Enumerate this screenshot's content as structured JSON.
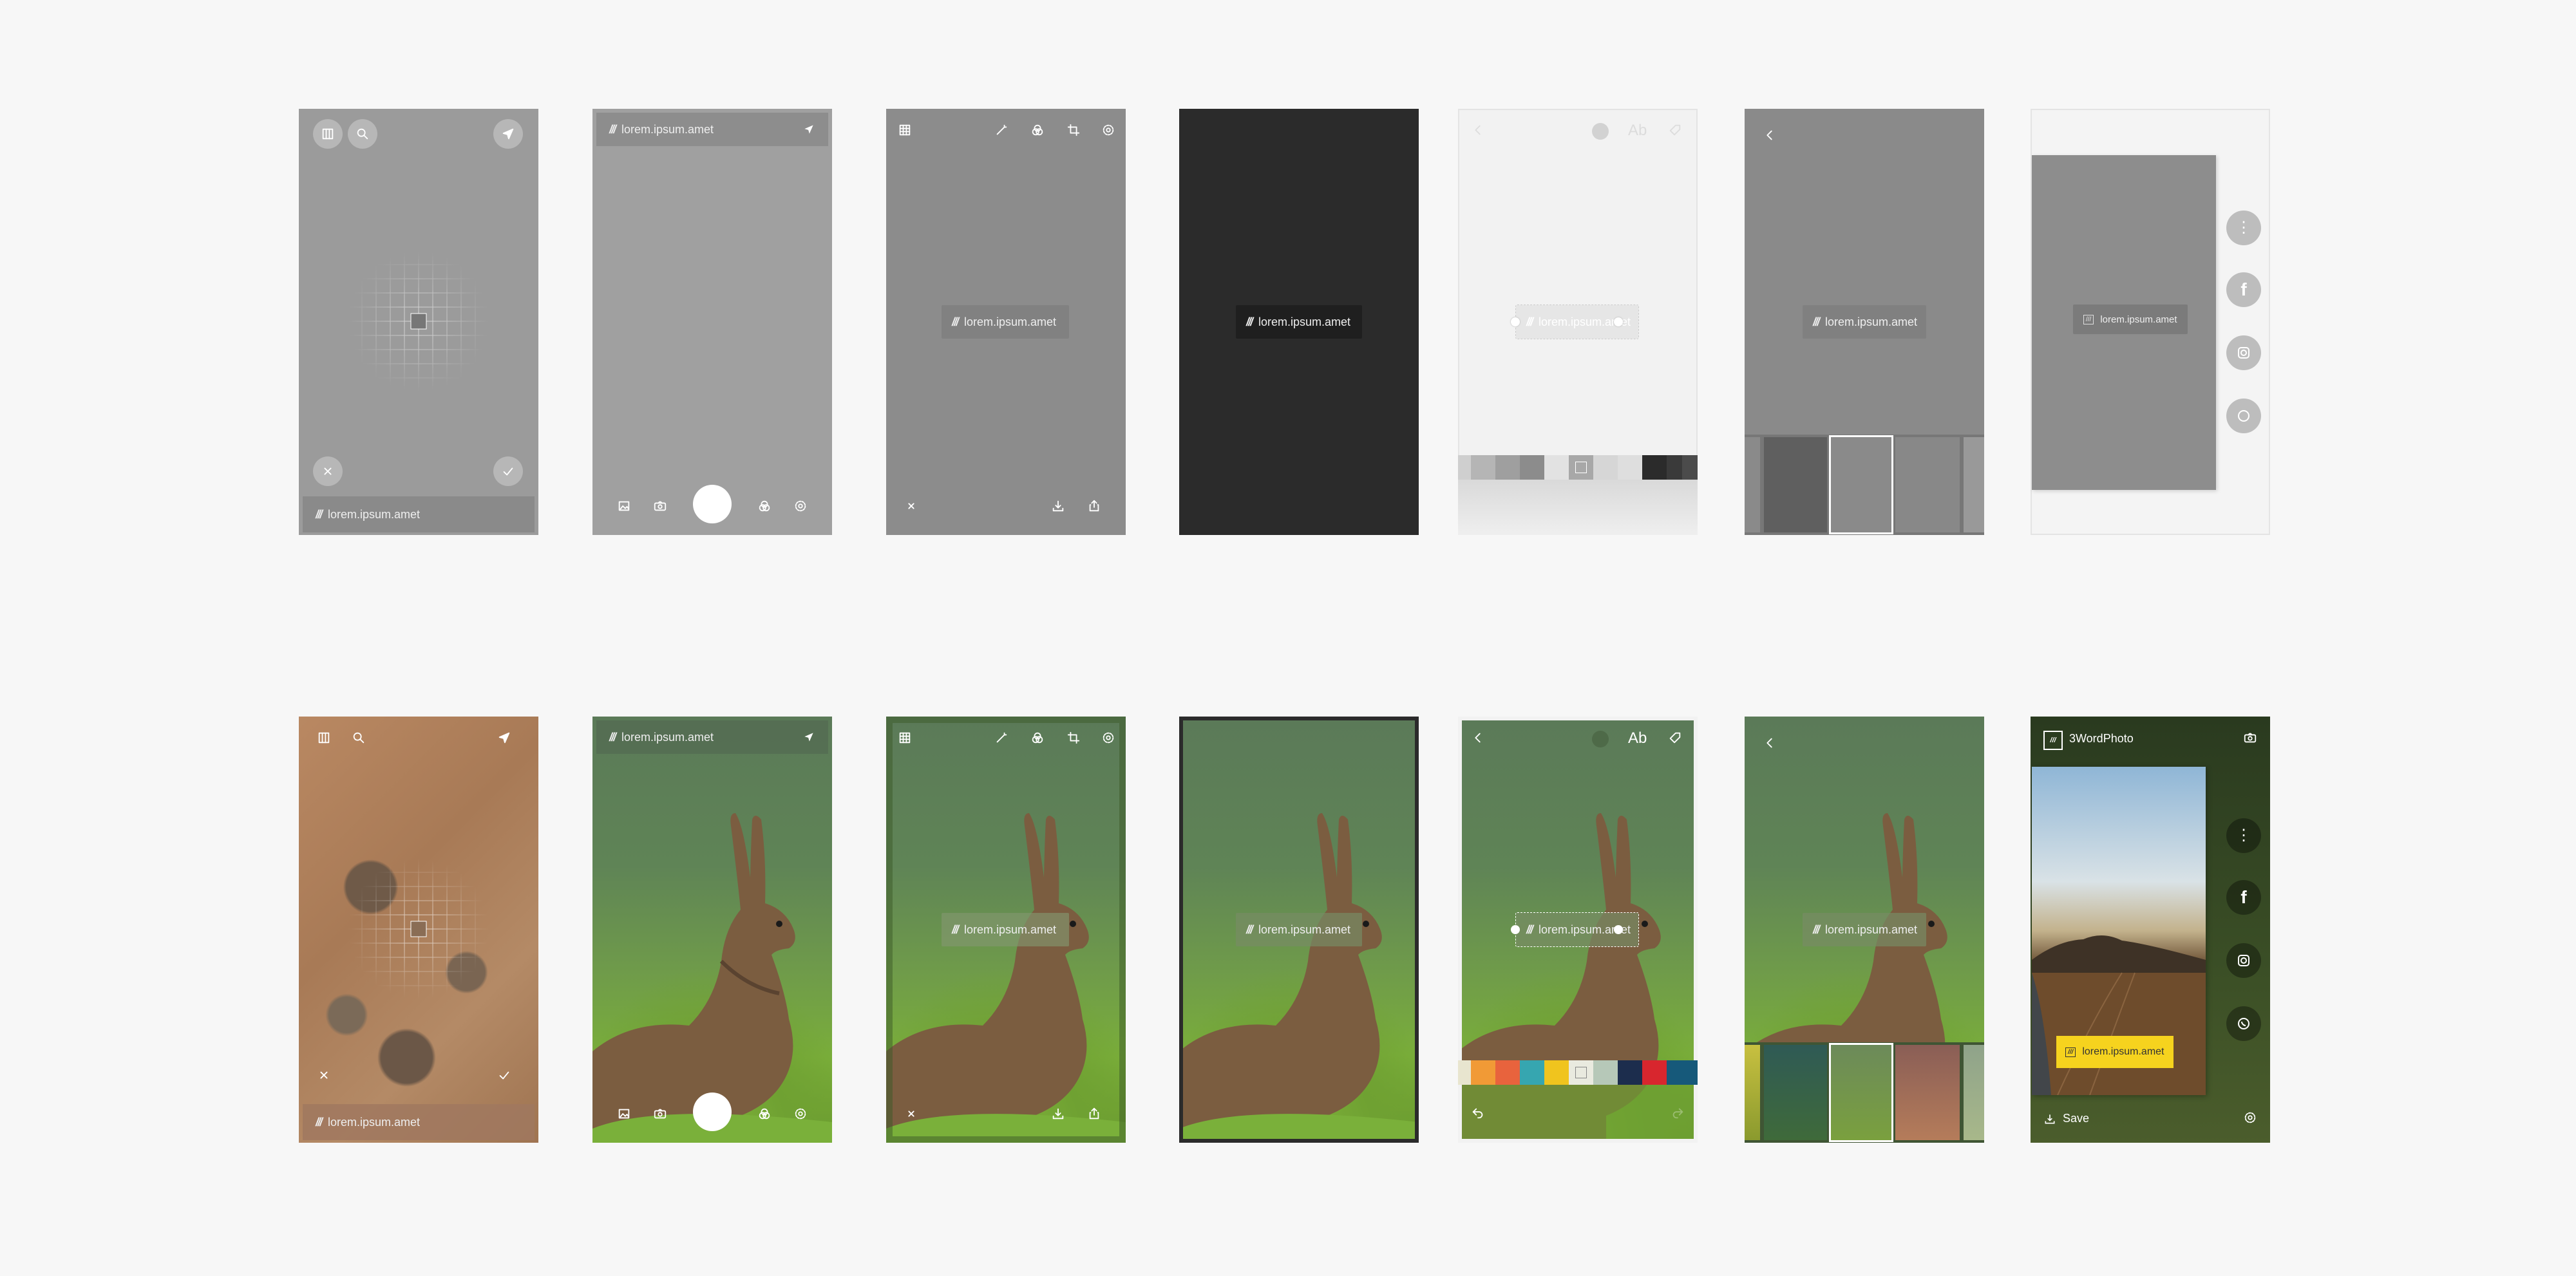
{
  "label_text": "lorem.ipsum.amet",
  "app_name": "3WordPhoto",
  "save_label": "Save",
  "text_tool": "Ab",
  "colors": {
    "swatches_gray": [
      "#b5b5b5",
      "#9f9f9f",
      "#8c8c8c",
      "#a8a8a8",
      "#d6d6d6",
      "#dedede",
      "#2b2b2b",
      "#3a3a3a",
      "#4b4b4b"
    ],
    "swatches_color": [
      "#e8e5cf",
      "#f19a36",
      "#e8633d",
      "#36a6b0",
      "#f0c41e",
      "#ffffff",
      "#b6c8b8",
      "#1c2d4d",
      "#d8262e",
      "#16597a"
    ],
    "highlight": "#f6d31e"
  }
}
